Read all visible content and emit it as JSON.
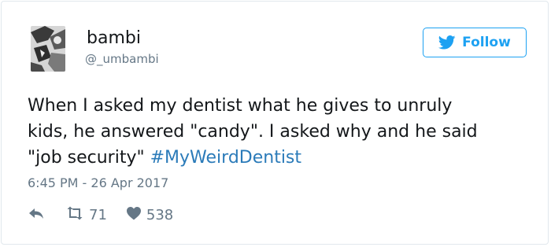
{
  "tweet": {
    "author_name": "bambi",
    "author_handle": "@_umbambi",
    "follow_label": "Follow",
    "text_lines": [
      "When I asked my dentist what he gives to unruly",
      "kids, he answered \"candy\". I asked why and he said",
      "\"job security\" "
    ],
    "hashtag": "#MyWeirdDentist",
    "timestamp": "6:45 PM - 26 Apr 2017",
    "retweet_count": "71",
    "like_count": "538"
  },
  "colors": {
    "accent": "#1da1f2",
    "hashtag": "#2b7bb9",
    "muted": "#657786",
    "text": "#14171a",
    "border": "#e1e8ed"
  },
  "icons": {
    "twitter": "twitter-bird-icon",
    "reply": "reply-icon",
    "retweet": "retweet-icon",
    "like": "heart-icon"
  }
}
